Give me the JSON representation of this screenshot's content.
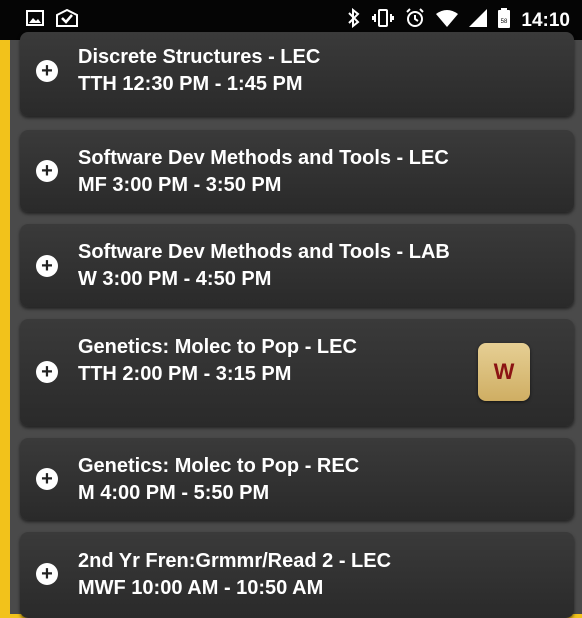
{
  "status_bar": {
    "time": "14:10",
    "left_icons": [
      "image-notification-icon",
      "mail-check-icon"
    ],
    "right_icons": [
      "bluetooth-icon",
      "vibrate-icon",
      "alarm-icon",
      "wifi-icon",
      "signal-icon",
      "battery-icon"
    ]
  },
  "courses": [
    {
      "title": "Discrete Structures - LEC",
      "time": "TTH 12:30 PM - 1:45 PM"
    },
    {
      "title": "Software Dev Methods and Tools - LEC",
      "time": "MF 3:00 PM - 3:50 PM"
    },
    {
      "title": "Software Dev Methods and Tools - LAB",
      "time": "W 3:00 PM - 4:50 PM"
    },
    {
      "title": "Genetics: Molec to Pop - LEC",
      "time": "TTH 2:00 PM - 3:15 PM",
      "badge": "W"
    },
    {
      "title": "Genetics: Molec to Pop - REC",
      "time": "M 4:00 PM - 5:50 PM"
    },
    {
      "title": "2nd Yr Fren:Grmmr/Read 2 - LEC",
      "time": "MWF 10:00 AM - 10:50 AM"
    }
  ],
  "colors": {
    "background": "#f2c21b",
    "status_bar": "#050505",
    "card": "#2f2f2f",
    "badge": "#dcc07c",
    "badge_text": "#8b1313"
  }
}
